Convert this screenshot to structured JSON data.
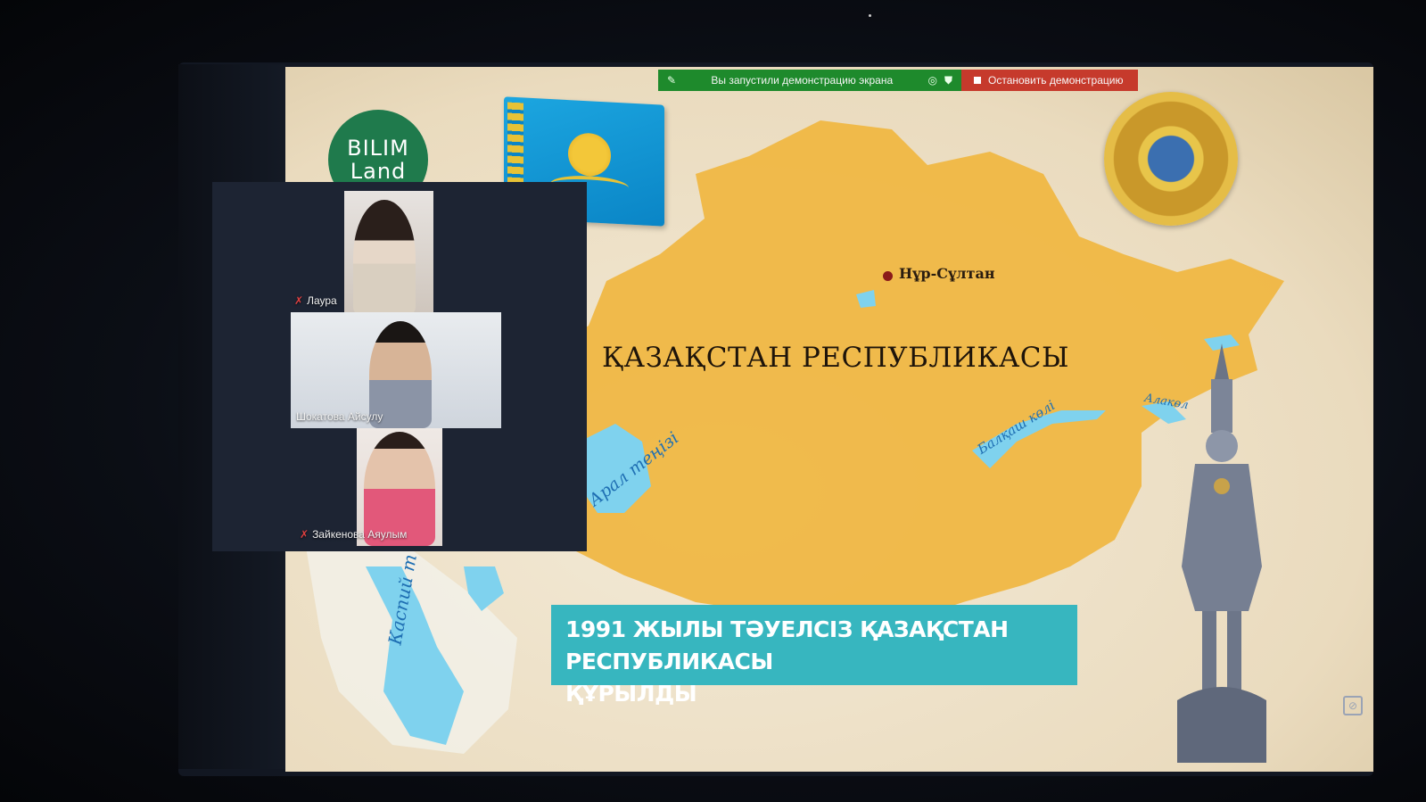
{
  "share_bar": {
    "status_text": "Вы запустили демонстрацию экрана",
    "stop_label": "Остановить демонстрацию"
  },
  "slide": {
    "logo_line1": "BILIM",
    "logo_line2": "Land",
    "capital": "Нұр-Сұлтан",
    "title": "ҚАЗАҚСТАН РЕСПУБЛИКАСЫ",
    "water_labels": {
      "aral": "Арал теңізі",
      "balkhash": "Балқаш көлі",
      "alakol": "Алакөл",
      "caspian": "Каспий т"
    },
    "banner_line1": "1991 ЖЫЛЫ ТӘУЕЛСІЗ ҚАЗАҚСТАН РЕСПУБЛИКАСЫ",
    "banner_line2": "ҚҰРЫЛДЫ"
  },
  "participants": [
    {
      "name": "Лаура",
      "muted": true
    },
    {
      "name": "Шокатова Айсулу",
      "muted": false
    },
    {
      "name": "Зайкенова Аяулым",
      "muted": true
    }
  ],
  "colors": {
    "share_green": "#1e8a2c",
    "stop_red": "#c63a2c",
    "banner_teal": "#37b6bf",
    "map_yellow": "#f0b640",
    "water_blue": "#5cc8ea"
  }
}
